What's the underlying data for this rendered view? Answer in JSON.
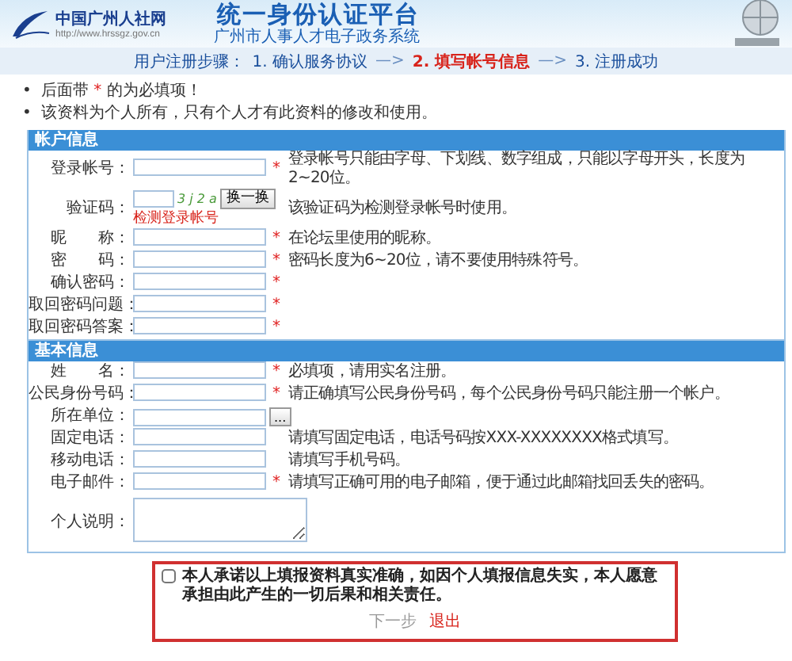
{
  "header": {
    "logo_name": "中国广州人社网",
    "logo_url": "http://www.hrssgz.gov.cn",
    "title": "统一身份认证平台",
    "subtitle": "广州市人事人才电子政务系统"
  },
  "steps": {
    "label": "用户注册步骤：",
    "separator": "—>",
    "items": [
      {
        "text": "1. 确认服务协议",
        "selected": false
      },
      {
        "text": "2. 填写帐号信息",
        "selected": true
      },
      {
        "text": "3. 注册成功",
        "selected": false
      }
    ]
  },
  "notes": [
    {
      "bullet": "•",
      "before": "后面带",
      "mark": "*",
      "after": "的为必填项！"
    },
    {
      "bullet": "•",
      "before": "该资料为个人所有，只有个人才有此资料的修改和使用。"
    }
  ],
  "sections": [
    {
      "title": "帐户信息",
      "rows": [
        {
          "label": "登录帐号：",
          "kind": "text",
          "required": true,
          "hint": "登录帐号只能由字母、下划线、数字组成，只能以字母开头，长度为2~20位。"
        },
        {
          "label": "验证码：",
          "kind": "captcha",
          "required": false,
          "captcha": "3 j 2 a",
          "button": "换一换",
          "link": "检测登录帐号",
          "hint": "该验证码为检测登录帐号时使用。"
        },
        {
          "label": "昵　　称：",
          "kind": "text",
          "required": true,
          "hint": "在论坛里使用的昵称。"
        },
        {
          "label": "密　　码：",
          "kind": "password",
          "required": true,
          "hint": "密码长度为6~20位，请不要使用特殊符号。"
        },
        {
          "label": "确认密码：",
          "kind": "password",
          "required": true
        },
        {
          "label": "取回密码问题：",
          "kind": "text",
          "required": true
        },
        {
          "label": "取回密码答案：",
          "kind": "text",
          "required": true
        }
      ]
    },
    {
      "title": "基本信息",
      "rows": [
        {
          "label": "姓　　名：",
          "kind": "text",
          "required": true,
          "hint": "必填项，请用实名注册。"
        },
        {
          "label": "公民身份号码：",
          "kind": "text",
          "required": true,
          "hint": "请正确填写公民身份号码，每个公民身份号码只能注册一个帐户。"
        },
        {
          "label": "所在单位：",
          "kind": "picker",
          "required": false,
          "button": "..."
        },
        {
          "label": "固定电话：",
          "kind": "text",
          "required": false,
          "hint": "请填写固定电话，电话号码按XXX-XXXXXXXX格式填写。"
        },
        {
          "label": "移动电话：",
          "kind": "text",
          "required": false,
          "hint": "请填写手机号码。"
        },
        {
          "label": "电子邮件：",
          "kind": "text",
          "required": true,
          "hint": "请填写正确可用的电子邮箱，便于通过此邮箱找回丢失的密码。"
        },
        {
          "label": "个人说明：",
          "kind": "textarea",
          "required": false
        }
      ]
    }
  ],
  "agreement": {
    "checked": false,
    "text": "本人承诺以上填报资料真实准确，如因个人填报信息失实，本人愿意承担由此产生的一切后果和相关责任。",
    "buttons": [
      {
        "label": "下一步",
        "disabled": true
      },
      {
        "label": "退出",
        "disabled": false
      }
    ]
  }
}
